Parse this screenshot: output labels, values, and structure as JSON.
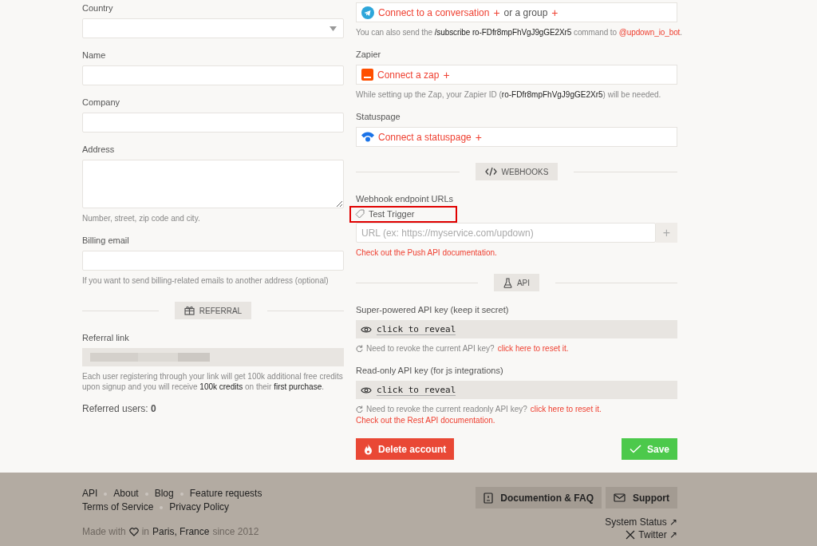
{
  "left": {
    "fields": [
      {
        "label": "Country",
        "kind": "select"
      },
      {
        "label": "Name",
        "kind": "input"
      },
      {
        "label": "Company",
        "kind": "input"
      },
      {
        "label": "Address",
        "kind": "textarea",
        "help": "Number, street, zip code and city."
      },
      {
        "label": "Billing email",
        "kind": "input",
        "help": "If you want to send billing-related emails to another address (optional)"
      }
    ],
    "referral_divider": "REFERRAL",
    "referral_link_label": "Referral link",
    "referral_text": [
      {
        "text": "Each user registering through your link will get 100k additional free credits upon signup and you will receive ",
        "strong": false
      },
      {
        "text": "100k credits",
        "strong": true
      },
      {
        "text": " on their ",
        "strong": false
      },
      {
        "text": "first purchase",
        "strong": true
      },
      {
        "text": ".",
        "strong": false
      }
    ],
    "referred_users": "Referred users: **0**"
  },
  "right": {
    "telegram": {
      "connect": "Connect to a conversation",
      "plus_1": "+",
      "or": "or a group",
      "plus_2": "+",
      "note": [
        {
          "text": "You can also send the ",
          "kind": "plain"
        },
        {
          "text": "/subscribe ro-FDfr8mpFhVgJ9gGE2Xr5",
          "kind": "code"
        },
        {
          "text": " command to ",
          "kind": "plain"
        },
        {
          "text": "@updown_io_bot",
          "kind": "link"
        },
        {
          "text": ".",
          "kind": "plain"
        }
      ]
    },
    "zapier": {
      "label": "Zapier",
      "connect": "Connect a zap",
      "plus": "+",
      "note": [
        {
          "text": "While setting up the Zap, your Zapier ID (",
          "kind": "plain"
        },
        {
          "text": "ro-FDfr8mpFhVgJ9gGE2Xr5",
          "kind": "code"
        },
        {
          "text": ") will be needed.",
          "kind": "plain"
        }
      ]
    },
    "statuspage": {
      "label": "Statuspage",
      "connect": "Connect a statuspage",
      "plus": "+"
    },
    "webhooks_divider": "WEBHOOKS",
    "webhooks": {
      "label": "Webhook endpoint URLs",
      "test_button": "Test Trigger",
      "highlighted": true,
      "placeholder": "URL (ex: https://myservice.com/updown)",
      "add": "+",
      "docs_link": "Check out the Push API documentation."
    },
    "api_divider": "API",
    "api_keys": [
      {
        "label": "Super-powered API key (keep it secret)",
        "reveal": "click to reveal",
        "note": "Need to revoke the current API key?",
        "reset_link": "click here to reset it."
      },
      {
        "label": "Read-only API key (for js integrations)",
        "reveal": "click to reveal",
        "note": "Need to revoke the current readonly API key?",
        "reset_link": "click here to reset it."
      }
    ],
    "rest_link": "Check out the Rest API documentation.",
    "delete_button": "Delete account",
    "save_button": "Save"
  },
  "footer": {
    "links_row_1": [
      "API",
      "About",
      "Blog",
      "Feature requests"
    ],
    "links_row_2": [
      "Terms of Service",
      "Privacy Policy"
    ],
    "made_with": "Made with",
    "in": "in",
    "place": "Paris, France",
    "since": "since 2012",
    "docs_button": "Documention & FAQ",
    "support_button": "Support",
    "status_link": "System Status ↗",
    "twitter_link": "Twitter ↗"
  }
}
